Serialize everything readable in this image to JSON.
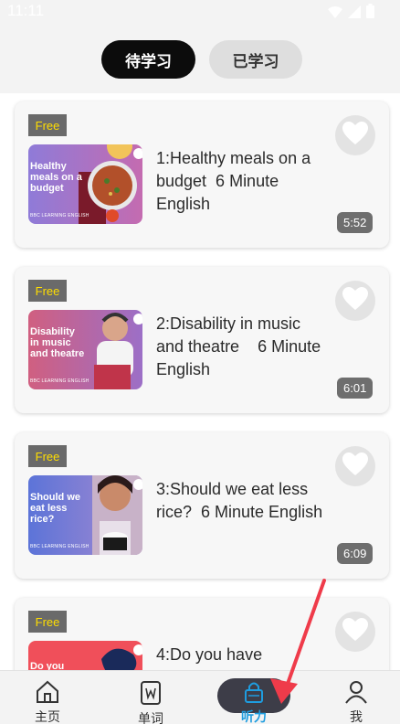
{
  "status_bar": {
    "time": "11:11"
  },
  "tabs": [
    {
      "label": "待学习",
      "active": true
    },
    {
      "label": "已学习",
      "active": false
    }
  ],
  "cards": [
    {
      "badge": "Free",
      "title": "1:Healthy meals on a budget  6 Minute English",
      "thumb_text": "Healthy meals on a budget",
      "thumb_footer": "BBC LEARNING ENGLISH",
      "duration": "5:52",
      "thumb_colors": [
        "#8f7bd8",
        "#c46bb0"
      ]
    },
    {
      "badge": "Free",
      "title": "2:Disability in music and theatre    6 Minute English",
      "thumb_text": "Disability in music and theatre",
      "thumb_footer": "BBC LEARNING ENGLISH",
      "duration": "6:01",
      "thumb_colors": [
        "#d05f80",
        "#9c6fc7"
      ]
    },
    {
      "badge": "Free",
      "title": "3:Should we eat less rice?  6 Minute English",
      "thumb_text": "Should we eat less rice?",
      "thumb_footer": "BBC LEARNING ENGLISH",
      "duration": "6:09",
      "thumb_colors": [
        "#5c74d8",
        "#a88ad0"
      ]
    },
    {
      "badge": "Free",
      "title": "4:Do you have",
      "thumb_text": "Do you have",
      "thumb_footer": "",
      "duration": "",
      "thumb_colors": [
        "#f04f5a",
        "#f27a6c"
      ]
    }
  ],
  "nav": [
    {
      "label": "主页",
      "icon": "home-icon",
      "active": false
    },
    {
      "label": "单词",
      "icon": "word-book-icon",
      "active": false
    },
    {
      "label": "听力",
      "icon": "lock-icon",
      "active": true
    },
    {
      "label": "我",
      "icon": "profile-icon",
      "active": false
    }
  ],
  "colors": {
    "accent": "#1e9de0",
    "badge_text": "#ffde00",
    "arrow": "#ef3b4a"
  }
}
